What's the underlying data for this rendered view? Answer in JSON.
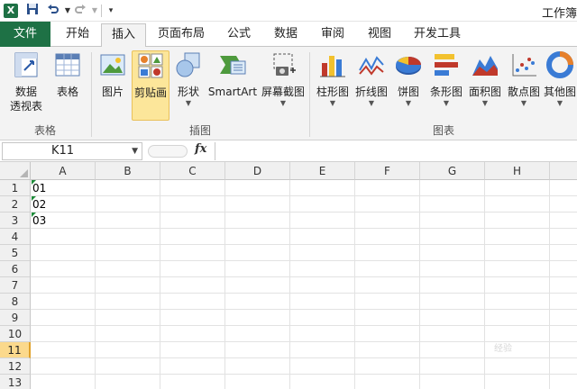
{
  "titlebar": {
    "logo": "X",
    "save_icon": "save-icon",
    "undo_icon": "undo-icon",
    "redo_icon": "redo-icon",
    "customize_icon": "customize-icon",
    "title": "工作簿"
  },
  "tabs": {
    "file": "文件",
    "items": [
      "开始",
      "插入",
      "页面布局",
      "公式",
      "数据",
      "审阅",
      "视图",
      "开发工具"
    ],
    "active": "插入"
  },
  "ribbon": {
    "groups": {
      "tables": "表格",
      "illustrations": "插图",
      "charts": "图表"
    },
    "buttons": {
      "pivot_line1": "数据",
      "pivot_line2": "透视表",
      "table": "表格",
      "picture": "图片",
      "clipart": "剪贴画",
      "shapes": "形状",
      "smartart": "SmartArt",
      "screenshot": "屏幕截图",
      "column": "柱形图",
      "line": "折线图",
      "pie": "饼图",
      "bar": "条形图",
      "area": "面积图",
      "scatter": "散点图",
      "other": "其他图"
    },
    "colors": {
      "accent_green": "#1e7145",
      "selected_fill": "#fce69a"
    }
  },
  "formula_bar": {
    "name_box": "K11",
    "fx": "fx",
    "content": ""
  },
  "sheet": {
    "columns": [
      "A",
      "B",
      "C",
      "D",
      "E",
      "F",
      "G",
      "H"
    ],
    "rows": [
      "1",
      "2",
      "3",
      "4",
      "5",
      "6",
      "7",
      "8",
      "9",
      "10",
      "11",
      "12",
      "13"
    ],
    "active_row": "11",
    "cells": {
      "A1": "01",
      "A2": "02",
      "A3": "03"
    }
  },
  "watermark": "经验"
}
